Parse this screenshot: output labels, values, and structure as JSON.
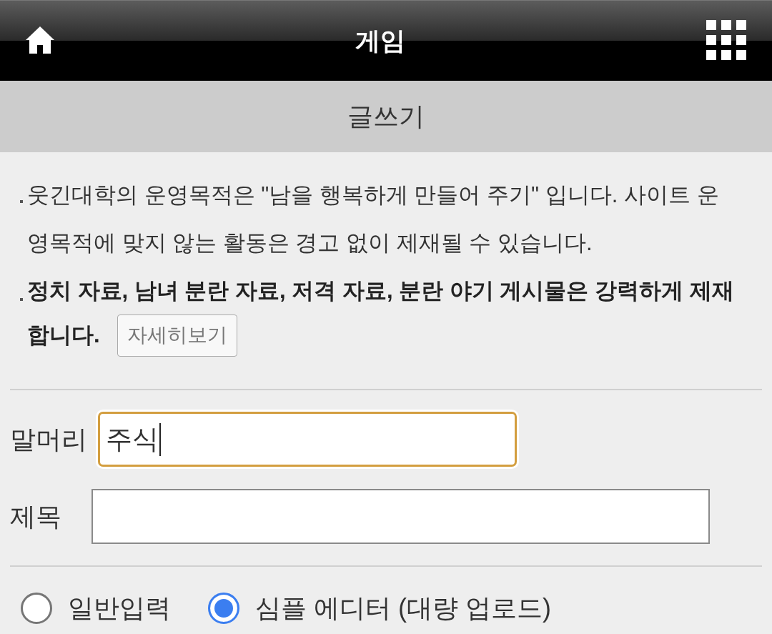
{
  "header": {
    "title": "게임"
  },
  "subheader": {
    "title": "글쓰기"
  },
  "notices": [
    {
      "text": "웃긴대학의 운영목적은 \"남을 행복하게 만들어 주기\" 입니다. 사이트 운영목적에 맞지 않는 활동은 경고 없이 제재될 수 있습니다.",
      "bold": false
    },
    {
      "lines": [
        "정치 자료, 남녀 분란 자료, 저격 자료, 분란 야기 게시물은 강력하게 제재",
        "합니다."
      ],
      "bold": true,
      "button": "자세히보기"
    }
  ],
  "fields": [
    {
      "label": "말머리",
      "value": "주식",
      "focused": true
    },
    {
      "label": "제목",
      "focused": false
    }
  ],
  "editor_modes": [
    {
      "label": "일반입력",
      "selected": false
    },
    {
      "label": "심플 에디터 (대량 업로드)",
      "selected": true
    }
  ]
}
